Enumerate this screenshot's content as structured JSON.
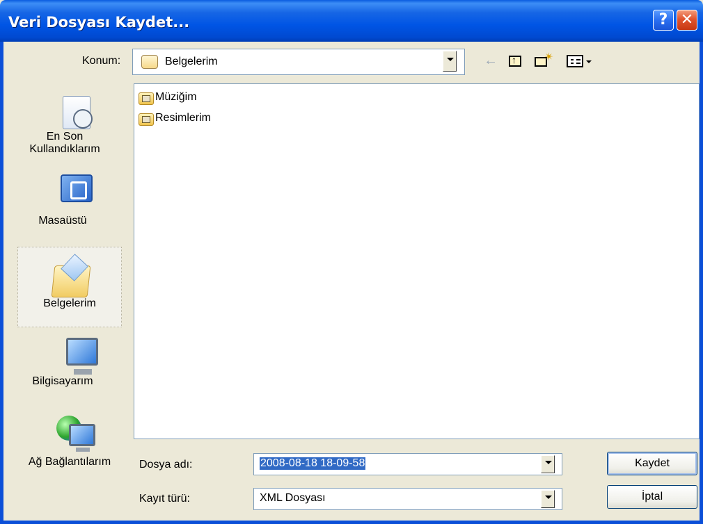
{
  "window": {
    "title": "Veri Dosyası Kaydet...",
    "help_label": "?",
    "close_label": "✕"
  },
  "location": {
    "label": "Konum:",
    "value": "Belgelerim"
  },
  "toolbar": {
    "back_icon": "back-arrow-icon",
    "up_icon": "up-folder-icon",
    "new_folder_icon": "new-folder-icon",
    "view_menu_icon": "view-menu-icon"
  },
  "places": [
    {
      "label_line1": "En Son",
      "label_line2": "Kullandıklarım",
      "icon": "recent-documents-icon"
    },
    {
      "label_line1": "Masaüstü",
      "icon": "desktop-icon"
    },
    {
      "label_line1": "Belgelerim",
      "icon": "my-documents-icon",
      "selected": true
    },
    {
      "label_line1": "Bilgisayarım",
      "icon": "my-computer-icon"
    },
    {
      "label_line1": "Ağ Bağlantılarım",
      "icon": "network-places-icon"
    }
  ],
  "files": [
    {
      "name": "Müziğim",
      "icon": "music-folder-icon"
    },
    {
      "name": "Resimlerim",
      "icon": "pictures-folder-icon"
    }
  ],
  "filename": {
    "label": "Dosya adı:",
    "value": "2008-08-18 18-09-58"
  },
  "filetype": {
    "label": "Kayıt türü:",
    "value": "XML Dosyası"
  },
  "buttons": {
    "save": "Kaydet",
    "cancel": "İptal"
  },
  "colors": {
    "titlebar": "#0055e5",
    "selection": "#316ac5",
    "dialog_bg": "#ece9d8"
  }
}
